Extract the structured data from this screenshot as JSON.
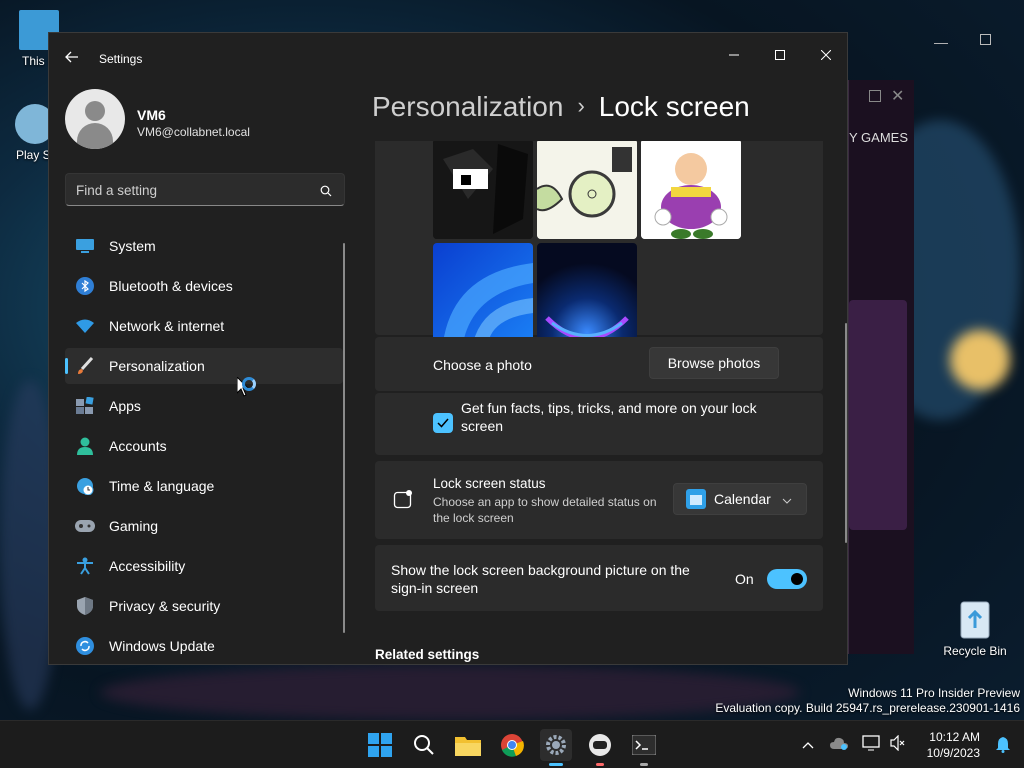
{
  "desktop": {
    "icons": [
      {
        "label": "This P",
        "icon": "this-pc-icon"
      },
      {
        "label": "Play St",
        "icon": "app-icon"
      },
      {
        "label": "Recycle Bin",
        "icon": "recycle-bin-icon"
      }
    ],
    "watermark": {
      "line1": "Windows 11 Pro Insider Preview",
      "line2": "Evaluation copy. Build 25947.rs_prerelease.230901-1416"
    },
    "background_window_text": "Y GAMES"
  },
  "settings": {
    "app_title": "Settings",
    "user": {
      "name": "VM6",
      "email": "VM6@collabnet.local"
    },
    "search": {
      "placeholder": "Find a setting"
    },
    "nav": [
      {
        "label": "System",
        "icon": "monitor-icon"
      },
      {
        "label": "Bluetooth & devices",
        "icon": "bluetooth-icon"
      },
      {
        "label": "Network & internet",
        "icon": "wifi-icon"
      },
      {
        "label": "Personalization",
        "icon": "brush-icon",
        "active": true
      },
      {
        "label": "Apps",
        "icon": "apps-icon"
      },
      {
        "label": "Accounts",
        "icon": "person-icon"
      },
      {
        "label": "Time & language",
        "icon": "clock-globe-icon"
      },
      {
        "label": "Gaming",
        "icon": "gamepad-icon"
      },
      {
        "label": "Accessibility",
        "icon": "accessibility-icon"
      },
      {
        "label": "Privacy & security",
        "icon": "shield-icon"
      },
      {
        "label": "Windows Update",
        "icon": "refresh-icon"
      }
    ],
    "breadcrumb": {
      "parent": "Personalization",
      "separator": "›",
      "current": "Lock screen"
    },
    "choose_photo": {
      "label": "Choose a photo",
      "button": "Browse photos"
    },
    "fun_facts": {
      "label": "Get fun facts, tips, tricks, and more on your lock screen",
      "checked": true
    },
    "lock_status": {
      "title": "Lock screen status",
      "description": "Choose an app to show detailed status on the lock screen",
      "selected": "Calendar"
    },
    "signin_bg": {
      "label": "Show the lock screen background picture on the sign-in screen",
      "state": "On",
      "on": true
    },
    "related": "Related settings"
  },
  "taskbar": {
    "apps": [
      "start-icon",
      "search-icon",
      "file-explorer-icon",
      "chrome-icon",
      "settings-icon",
      "app-icon",
      "terminal-icon"
    ],
    "clock": {
      "time": "10:12 AM",
      "date": "10/9/2023"
    }
  },
  "colors": {
    "accent": "#4cc2ff",
    "window_bg": "#202020",
    "card_bg": "#2b2b2b"
  }
}
